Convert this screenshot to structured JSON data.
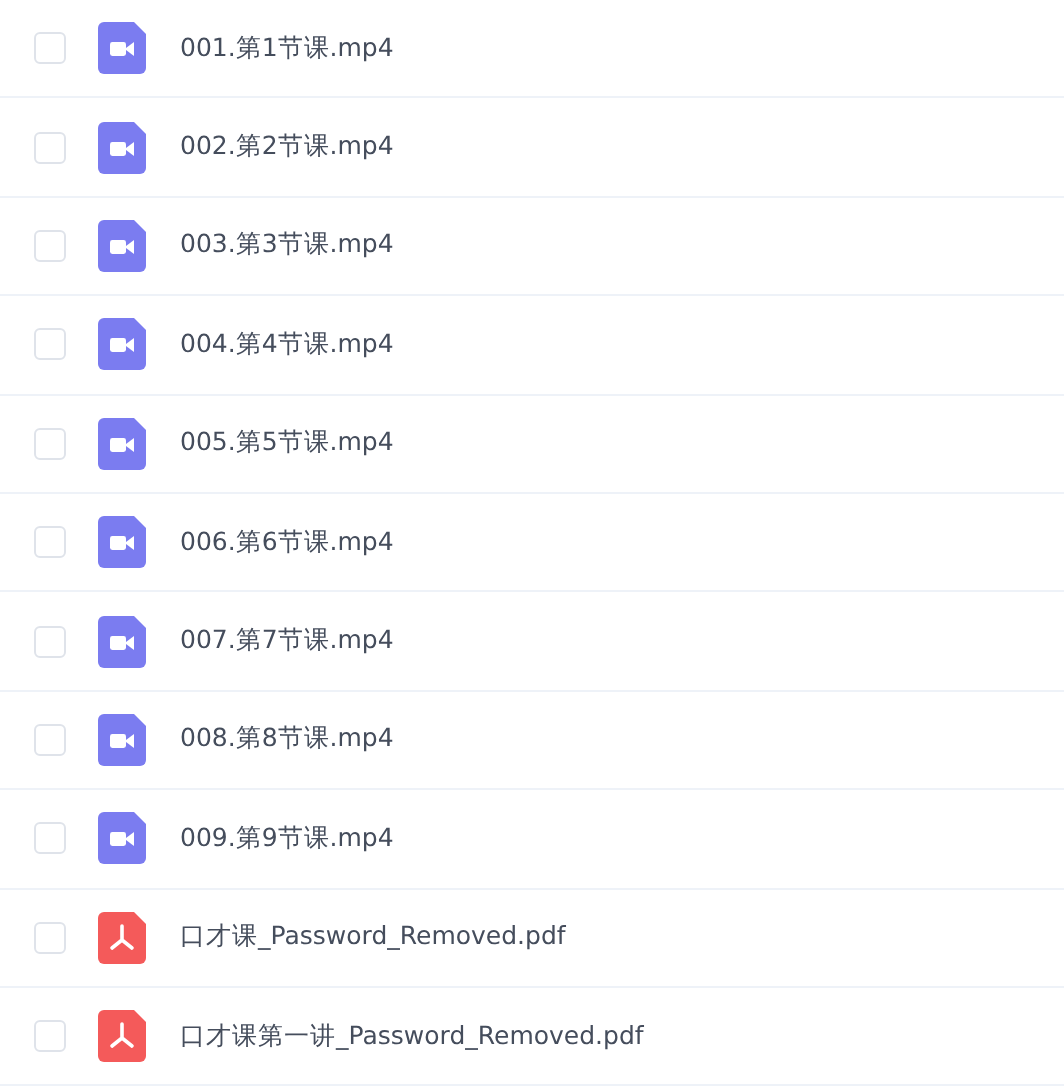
{
  "files": [
    {
      "kind": "video",
      "name": "001.第1节课.mp4",
      "checked": false
    },
    {
      "kind": "video",
      "name": "002.第2节课.mp4",
      "checked": false
    },
    {
      "kind": "video",
      "name": "003.第3节课.mp4",
      "checked": false
    },
    {
      "kind": "video",
      "name": "004.第4节课.mp4",
      "checked": false
    },
    {
      "kind": "video",
      "name": "005.第5节课.mp4",
      "checked": false
    },
    {
      "kind": "video",
      "name": "006.第6节课.mp4",
      "checked": false
    },
    {
      "kind": "video",
      "name": "007.第7节课.mp4",
      "checked": false
    },
    {
      "kind": "video",
      "name": "008.第8节课.mp4",
      "checked": false
    },
    {
      "kind": "video",
      "name": "009.第9节课.mp4",
      "checked": false
    },
    {
      "kind": "pdf",
      "name": "口才课_Password_Removed.pdf",
      "checked": false
    },
    {
      "kind": "pdf",
      "name": "口才课第一讲_Password_Removed.pdf",
      "checked": false
    }
  ]
}
